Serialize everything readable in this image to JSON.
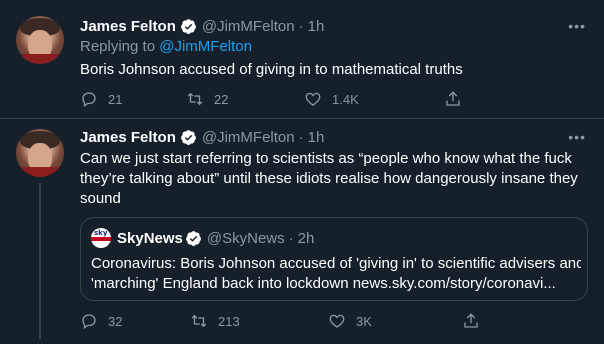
{
  "tweet1": {
    "name": "James Felton",
    "handle": "@JimMFelton",
    "time": "1h",
    "replying_label": "Replying to ",
    "replying_handle": "@JimMFelton",
    "text": "Boris Johnson accused of giving in to mathematical truths",
    "replies": "21",
    "retweets": "22",
    "likes": "1.4K"
  },
  "tweet2": {
    "name": "James Felton",
    "handle": "@JimMFelton",
    "time": "1h",
    "text_line1": "Can we just start referring to scientists as “people who know what the fuck",
    "text_line2": "they’re talking about” until these idiots realise how dangerously insane they",
    "text_line3": "sound",
    "quote": {
      "name": "SkyNews",
      "handle": "@SkyNews",
      "time": "2h",
      "logo_text": "sky news",
      "text_line1": "Coronavirus: Boris Johnson accused of 'giving in' to scientific advisers and",
      "text_line2": "'marching' England back into lockdown news.sky.com/story/coronavi..."
    },
    "replies": "32",
    "retweets": "213",
    "likes": "3K"
  },
  "separator": "·",
  "more_label": "•••",
  "icons": {
    "verified": "verified-badge-icon",
    "reply": "reply-icon",
    "retweet": "retweet-icon",
    "like": "heart-icon",
    "share": "share-icon"
  },
  "colors": {
    "background": "#15202b",
    "accent": "#1da1f2",
    "muted": "#8899a6",
    "border": "#38444d"
  }
}
